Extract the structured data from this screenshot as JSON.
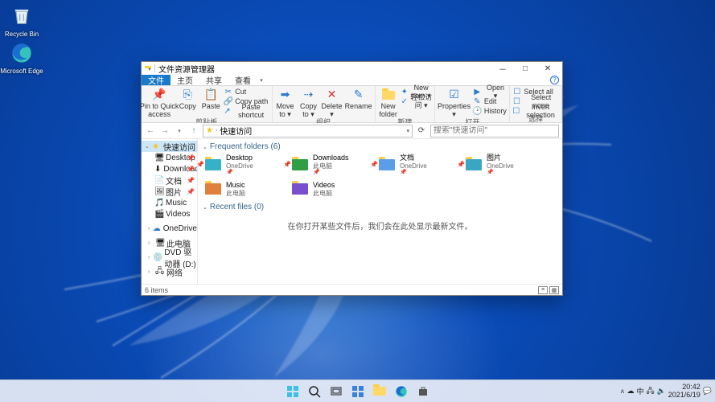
{
  "desktop_icons": [
    {
      "name": "Recycle Bin",
      "icon": "recycle"
    },
    {
      "name": "Microsoft Edge",
      "icon": "edge"
    }
  ],
  "window": {
    "title": "文件资源管理器",
    "controls": {
      "min": "－",
      "max": "□",
      "close": "✕"
    },
    "tabs": [
      "文件",
      "主页",
      "共享",
      "查看"
    ],
    "active_tab": "文件",
    "help": "?",
    "ribbon": {
      "clipboard": {
        "label": "剪贴板",
        "pin": "Pin to Quick\naccess",
        "copy": "Copy",
        "paste": "Paste",
        "copypath": "Copy path",
        "shortcut": "Paste shortcut",
        "cut": "Cut"
      },
      "organize": {
        "label": "组织",
        "move": "Move\nto ▾",
        "copyto": "Copy\nto ▾",
        "delete": "Delete\n▾",
        "rename": "Rename"
      },
      "new": {
        "label": "新建",
        "folder": "New\nfolder",
        "item": "New item ▾",
        "easy": "轻松访问 ▾"
      },
      "open": {
        "label": "打开",
        "props": "Properties\n▾",
        "open": "Open ▾",
        "edit": "Edit",
        "history": "History"
      },
      "select": {
        "label": "选择",
        "all": "Select all",
        "none": "Select none",
        "inv": "Invert selection"
      }
    },
    "address": {
      "current": "快速访问",
      "dd": "▾",
      "refresh": "⟳"
    },
    "search": {
      "placeholder": "搜索\"快速访问\""
    },
    "nav": {
      "quick": "快速访问",
      "quick_items": [
        {
          "label": "Desktop",
          "ico": "🖥",
          "pin": true
        },
        {
          "label": "Downloads",
          "ico": "⬇",
          "pin": true
        },
        {
          "label": "文档",
          "ico": "📄",
          "pin": true
        },
        {
          "label": "图片",
          "ico": "🖼",
          "pin": true
        },
        {
          "label": "Music",
          "ico": "🎵",
          "pin": false
        },
        {
          "label": "Videos",
          "ico": "🎬",
          "pin": false
        }
      ],
      "onedrive": "OneDrive",
      "pc": "此电脑",
      "dvd": "DVD 驱动器 (D:)",
      "net": "网络"
    },
    "groups": {
      "freq": "Frequent folders (6)",
      "recent": "Recent files (0)",
      "folders": [
        {
          "name": "Desktop",
          "sub": "OneDrive",
          "ico": "#35b2c7",
          "pin": true
        },
        {
          "name": "Downloads",
          "sub": "此电脑",
          "ico": "#2f9e44",
          "pin": true
        },
        {
          "name": "文档",
          "sub": "OneDrive",
          "ico": "#5c9de8",
          "pin": true
        },
        {
          "name": "图片",
          "sub": "OneDrive",
          "ico": "#3ba5c4",
          "pin": true
        },
        {
          "name": "Music",
          "sub": "此电脑",
          "ico": "#e07f3e",
          "pin": false
        },
        {
          "name": "Videos",
          "sub": "此电脑",
          "ico": "#7a4fce",
          "pin": false
        }
      ],
      "empty": "在你打开某些文件后，我们会在此处显示最新文件。"
    },
    "status": {
      "count": "6 items"
    }
  },
  "taskbar": {
    "tray": {
      "ime": "中",
      "time": "20:42",
      "date": "2021/6/19"
    }
  }
}
